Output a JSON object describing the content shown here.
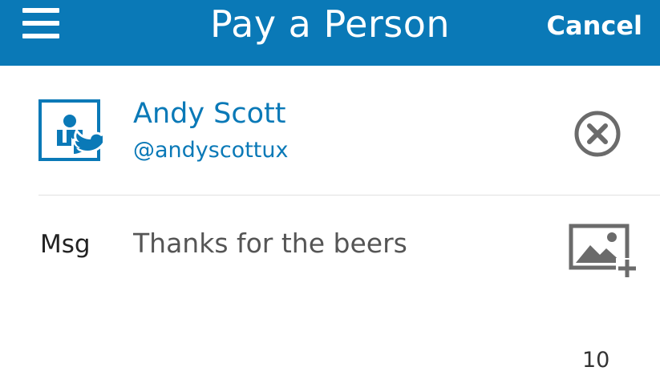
{
  "header": {
    "title": "Pay a Person",
    "cancel_label": "Cancel",
    "menu_icon": "hamburger-menu-icon",
    "background_color": "#0a79b7"
  },
  "recipient": {
    "name": "Andy Scott",
    "handle": "@andyscottux",
    "avatar_icon": "person-with-twitter-bird-icon",
    "remove_icon": "circle-x-icon",
    "accent_color": "#0a79b7"
  },
  "message": {
    "label": "Msg",
    "value": "Thanks for the beers",
    "add_image_icon": "add-image-icon",
    "char_count": "10"
  }
}
